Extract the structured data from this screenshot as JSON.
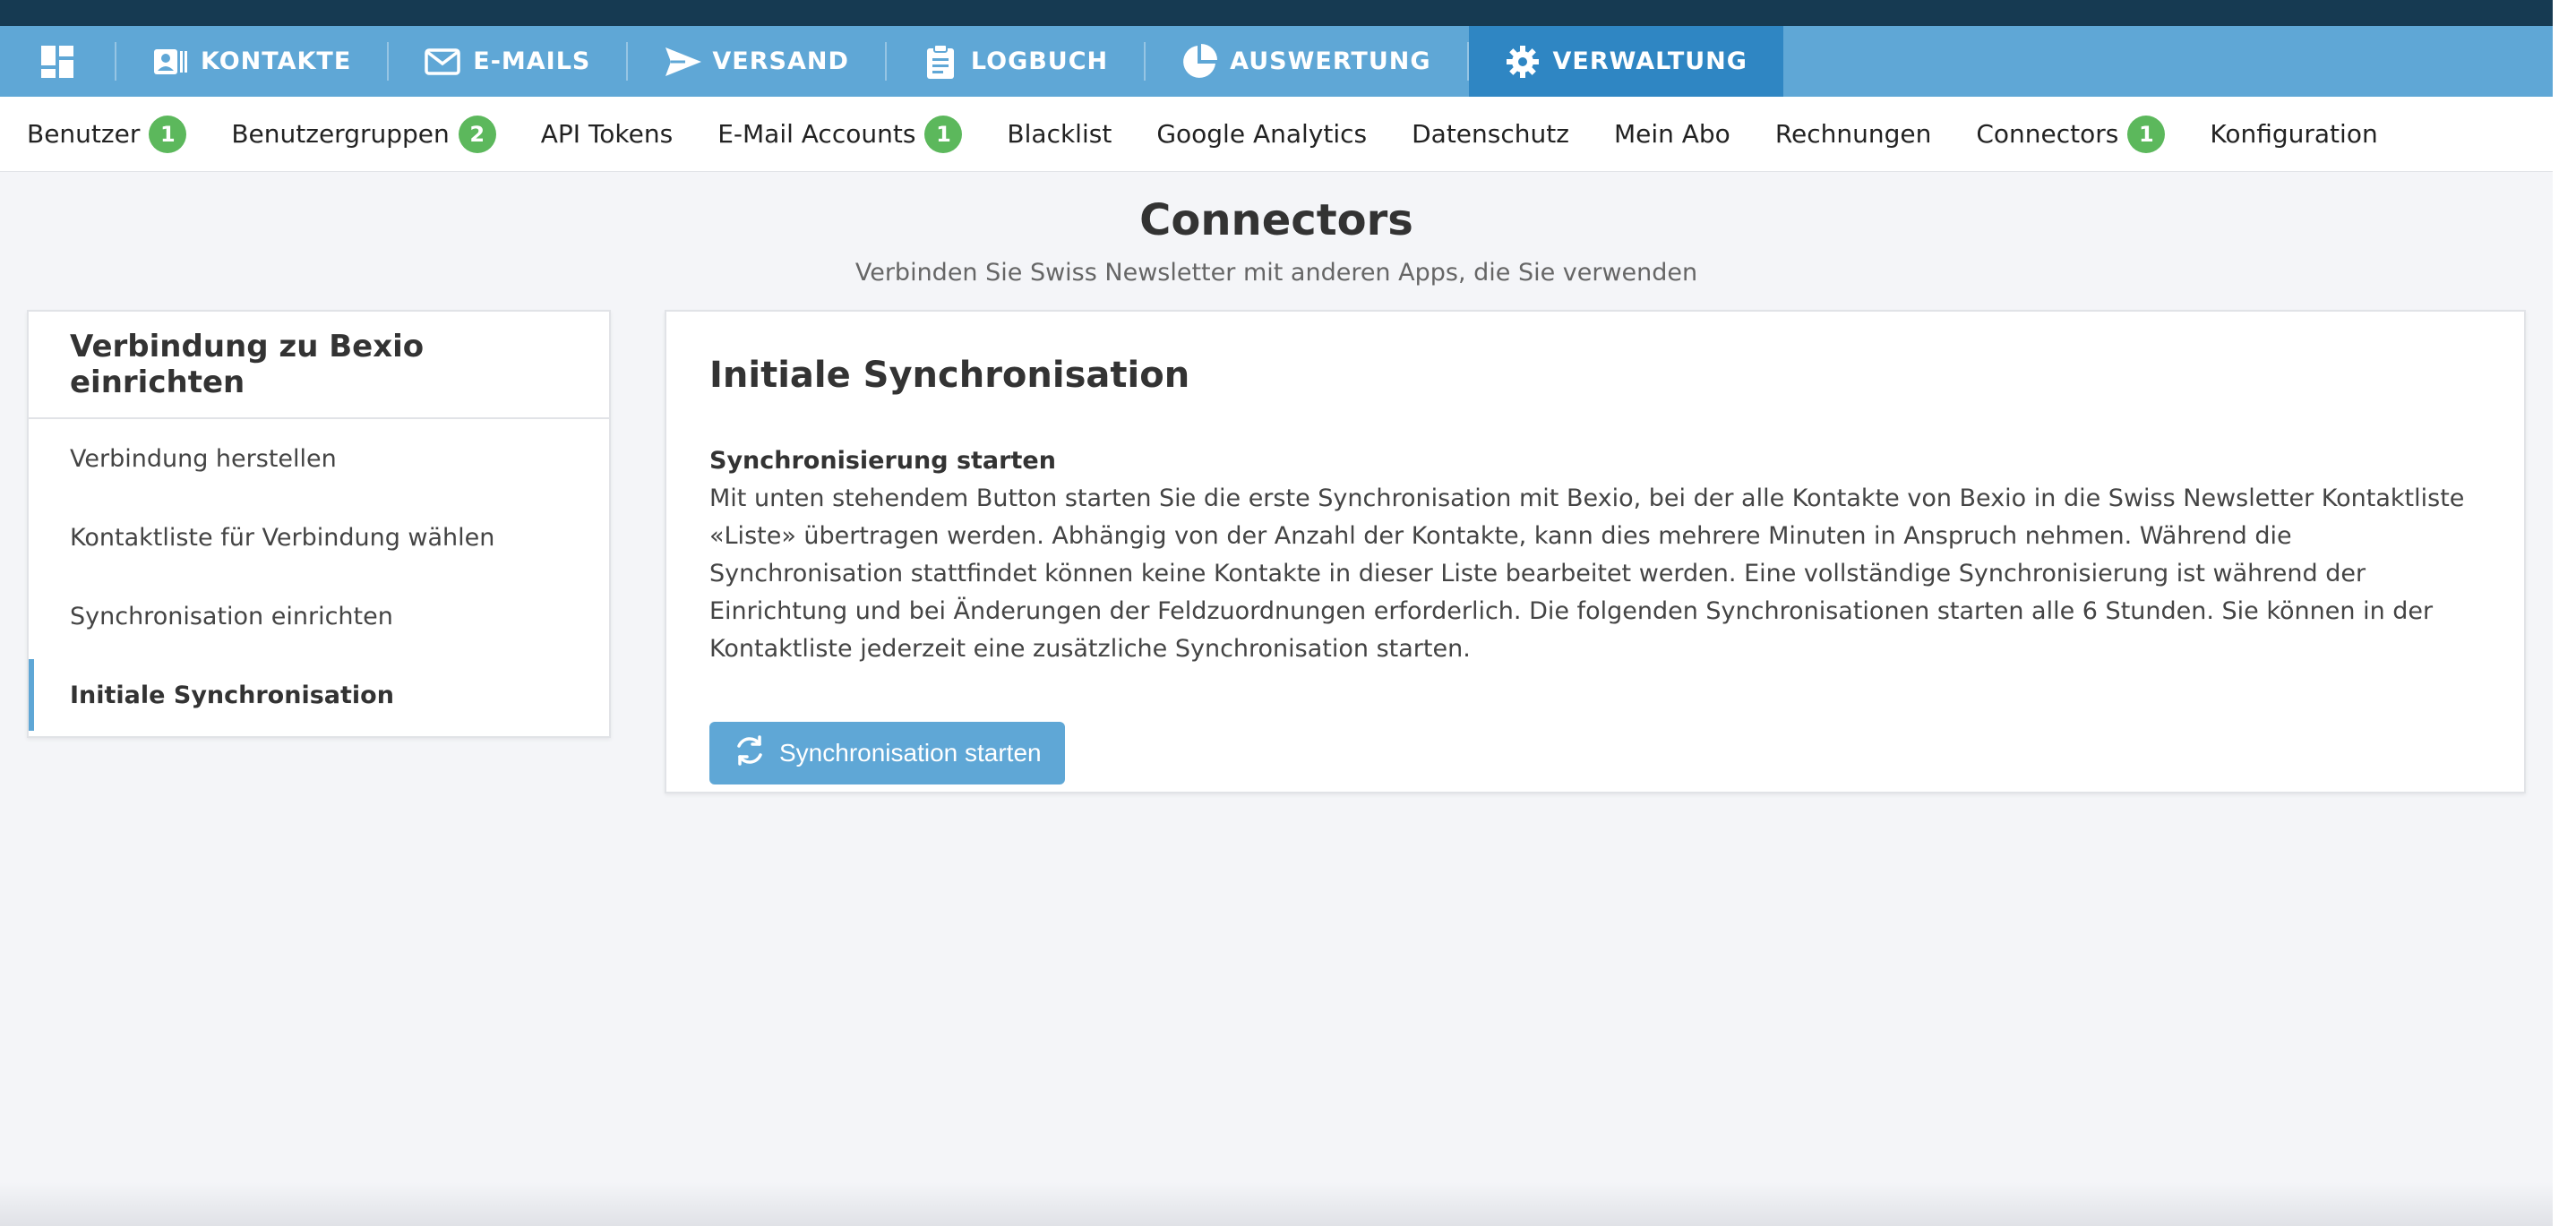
{
  "mainnav": {
    "items": [
      {
        "label": "KONTAKTE",
        "icon": "contacts-icon"
      },
      {
        "label": "E-MAILS",
        "icon": "envelope-icon"
      },
      {
        "label": "VERSAND",
        "icon": "send-icon"
      },
      {
        "label": "LOGBUCH",
        "icon": "clipboard-icon"
      },
      {
        "label": "AUSWERTUNG",
        "icon": "pie-chart-icon"
      },
      {
        "label": "VERWALTUNG",
        "icon": "gear-icon",
        "active": true
      }
    ]
  },
  "subnav": {
    "items": [
      {
        "label": "Benutzer",
        "badge": "1"
      },
      {
        "label": "Benutzergruppen",
        "badge": "2"
      },
      {
        "label": "API Tokens"
      },
      {
        "label": "E-Mail Accounts",
        "badge": "1"
      },
      {
        "label": "Blacklist"
      },
      {
        "label": "Google Analytics"
      },
      {
        "label": "Datenschutz"
      },
      {
        "label": "Mein Abo"
      },
      {
        "label": "Rechnungen"
      },
      {
        "label": "Connectors",
        "badge": "1"
      },
      {
        "label": "Konfiguration"
      }
    ]
  },
  "page": {
    "title": "Connectors",
    "subtitle": "Verbinden Sie Swiss Newsletter mit anderen Apps, die Sie verwenden"
  },
  "sidebar": {
    "title": "Verbindung zu Bexio einrichten",
    "items": [
      {
        "label": "Verbindung herstellen"
      },
      {
        "label": "Kontaktliste für Verbindung wählen"
      },
      {
        "label": "Synchronisation einrichten"
      },
      {
        "label": "Initiale Synchronisation",
        "active": true
      }
    ]
  },
  "main": {
    "title": "Initiale Synchronisation",
    "section_heading": "Synchronisierung starten",
    "section_text": "Mit unten stehendem Button starten Sie die erste Synchronisation mit Bexio, bei der alle Kontakte von Bexio in die Swiss Newsletter Kontaktliste «Liste» übertragen werden. Abhängig von der Anzahl der Kontakte, kann dies mehrere Minuten in Anspruch nehmen. Während die Synchronisation stattfindet können keine Kontakte in dieser Liste bearbeitet werden. Eine vollständige Synchronisierung ist während der Einrichtung und bei Änderungen der Feldzuordnungen erforderlich. Die folgenden Synchronisationen starten alle 6 Stunden. Sie können in der Kontaktliste jederzeit eine zusätzliche Synchronisation starten.",
    "button_label": "Synchronisation starten",
    "button_icon": "sync-icon"
  },
  "colors": {
    "nav_bg": "#5fa7d6",
    "nav_active": "#2f86c3",
    "badge": "#5cb85c",
    "top_strip": "#163a52"
  }
}
